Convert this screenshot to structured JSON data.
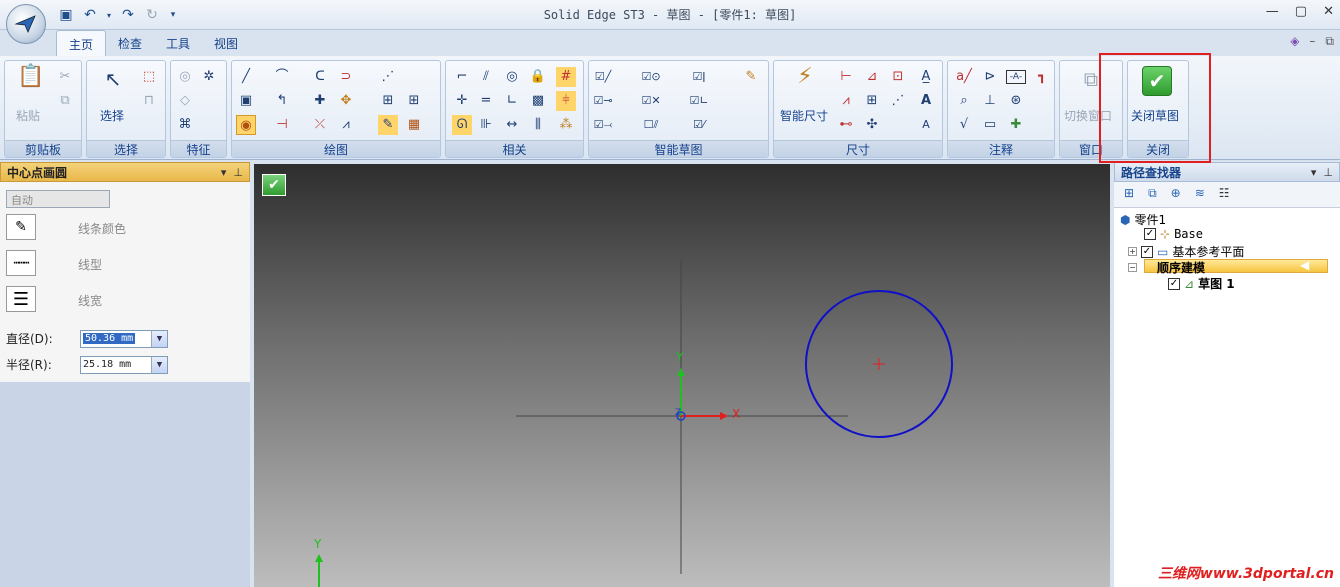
{
  "window": {
    "title": "Solid Edge ST3 - 草图 - [零件1: 草图]"
  },
  "tabs": [
    "主页",
    "检查",
    "工具",
    "视图"
  ],
  "ribbon": {
    "groups": {
      "clipboard": "剪贴板",
      "select": "选择",
      "features": "特征",
      "draw": "绘图",
      "relate": "相关",
      "intellisketch": "智能草图",
      "dimension": "尺寸",
      "annotation": "注释",
      "window": "窗口",
      "close": "关闭"
    },
    "buttons": {
      "paste": "粘贴",
      "select": "选择",
      "smart_dimension": "智能尺寸",
      "switch_window": "切换窗口",
      "close_sketch": "关闭草图"
    }
  },
  "left_panel": {
    "title": "中心点画圆",
    "mode_select": "自动",
    "line_color": "线条颜色",
    "line_type": "线型",
    "line_width": "线宽",
    "diameter_label": "直径(D):",
    "diameter_value": "50.36 mm",
    "radius_label": "半径(R):",
    "radius_value": "25.18 mm"
  },
  "canvas": {
    "axis_y": "Y",
    "axis_x": "X",
    "axis_z": "Z",
    "circle_color": "#1010c8",
    "center_color": "#e02020"
  },
  "pathfinder": {
    "title": "路径查找器",
    "tree": {
      "root": "零件1",
      "base": "Base",
      "ref_planes": "基本参考平面",
      "ordered": "顺序建模",
      "sketch": "草图 1"
    }
  },
  "watermark": "三维网www.3dportal.cn",
  "colors": {
    "highlight_box": "#e02020",
    "accent": "#15428b"
  }
}
